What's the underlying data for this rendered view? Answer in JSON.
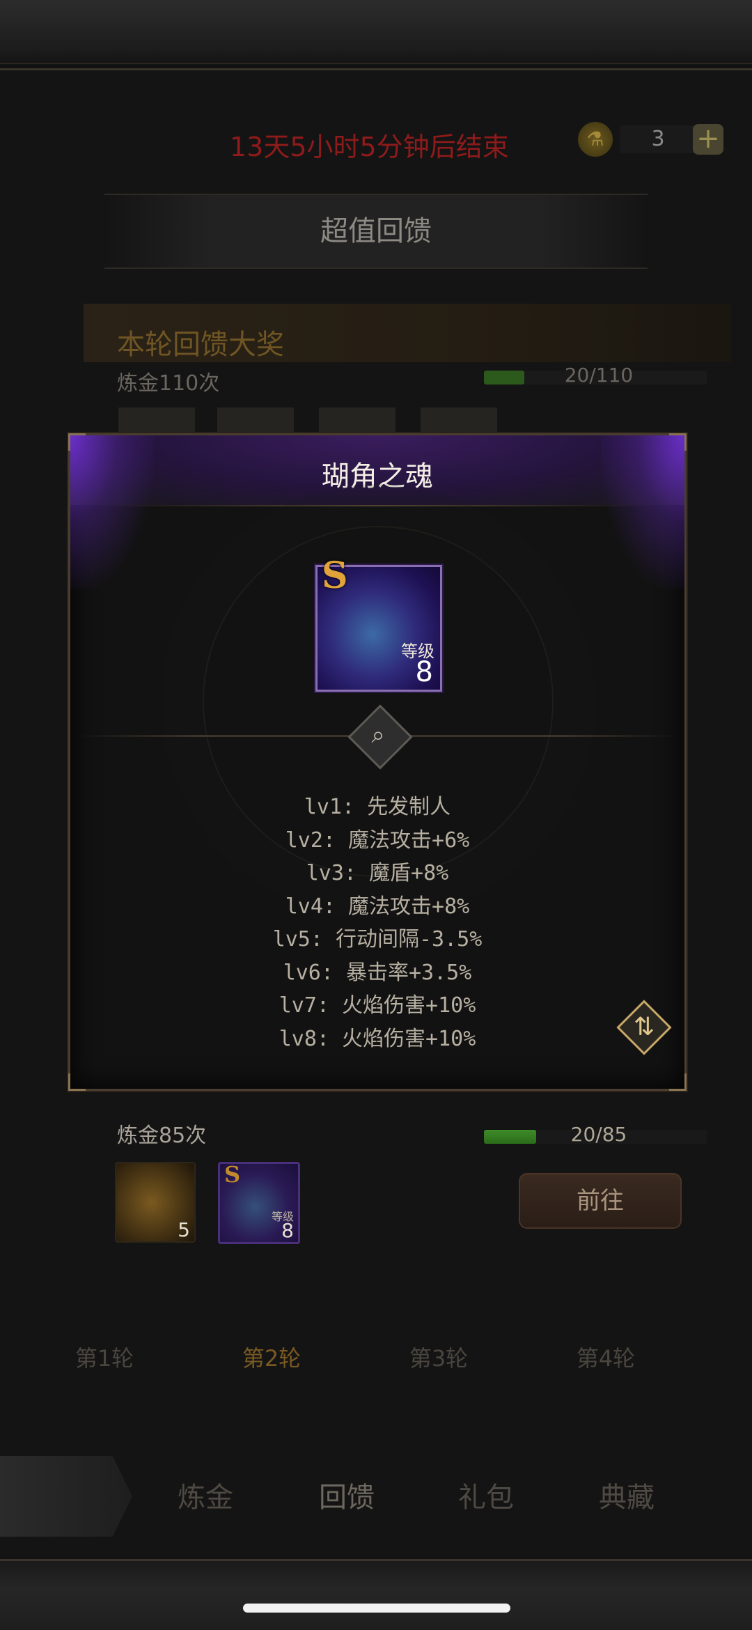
{
  "header": {
    "timer": "13天5小时5分钟后结束",
    "currency_count": "3",
    "add_label": "+"
  },
  "section": {
    "title": "超值回馈"
  },
  "grand_prize": {
    "title": "本轮回馈大奖",
    "row1_label": "炼金110次",
    "row1_progress_text": "20/110",
    "row1_progress": 0.18
  },
  "reward_row": {
    "label": "炼金85次",
    "progress_text": "20/85",
    "progress": 0.235,
    "potion_count": "5",
    "soul_s": "S",
    "soul_level_label": "等级",
    "soul_level": "8",
    "goto_label": "前往"
  },
  "round_tabs": [
    "第1轮",
    "第2轮",
    "第3轮",
    "第4轮"
  ],
  "bottom_nav": [
    "炼金",
    "回馈",
    "礼包",
    "典藏"
  ],
  "modal": {
    "title": "瑚角之魂",
    "item_s": "S",
    "item_level_label": "等级",
    "item_level": "8",
    "skills": [
      "lv1: 先发制人",
      "lv2: 魔法攻击+6%",
      "lv3: 魔盾+8%",
      "lv4: 魔法攻击+8%",
      "lv5: 行动间隔-3.5%",
      "lv6: 暴击率+3.5%",
      "lv7: 火焰伤害+10%",
      "lv8: 火焰伤害+10%"
    ],
    "icons": {
      "magnifier": "magnifier-icon",
      "sort": "sort-icon"
    }
  },
  "colors": {
    "timer": "#8e1b1b",
    "accent_gold": "#c9a969",
    "modal_purple": "#6a2fc8"
  }
}
